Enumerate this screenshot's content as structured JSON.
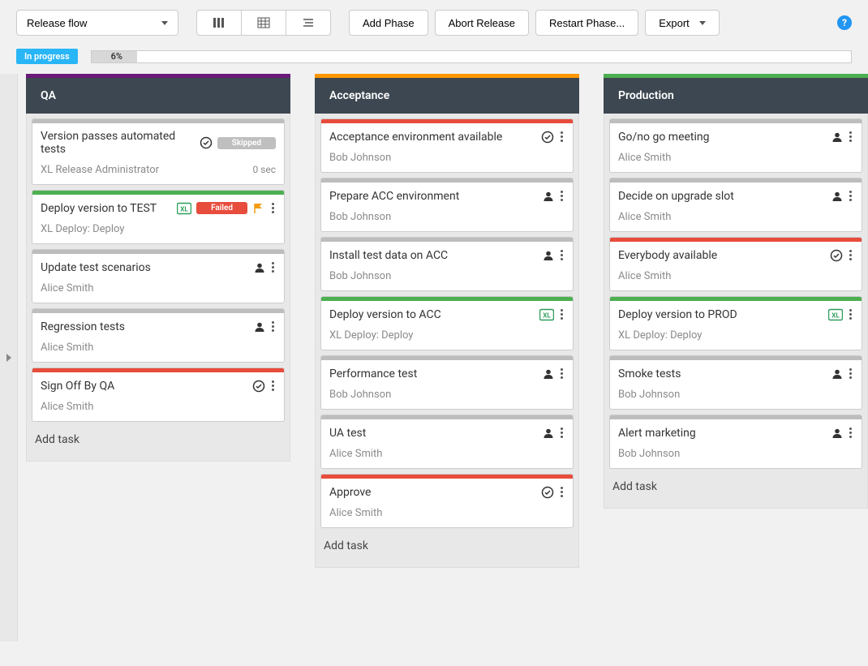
{
  "toolbar": {
    "view_label": "Release flow",
    "add_phase": "Add Phase",
    "abort_release": "Abort Release",
    "restart_phase": "Restart Phase...",
    "export": "Export"
  },
  "progress": {
    "status_label": "In progress",
    "percent_label": "6%",
    "percent_value": 6
  },
  "phases": [
    {
      "title": "QA",
      "color": "col-purple",
      "tasks": [
        {
          "title": "Version passes automated tests",
          "assignee": "XL Release Administrator",
          "bar": "bar-gray",
          "type": "gate",
          "chip": {
            "label": "Skipped",
            "cls": "chip-skipped"
          },
          "right_meta": "0 sec",
          "show_kebab": false,
          "show_person": false
        },
        {
          "title": "Deploy version to TEST",
          "assignee": "XL Deploy: Deploy",
          "bar": "bar-green",
          "type": "xl",
          "chip": {
            "label": "Failed",
            "cls": "chip-failed"
          },
          "flag": true,
          "show_kebab": true,
          "show_person": false
        },
        {
          "title": "Update test scenarios",
          "assignee": "Alice Smith",
          "bar": "bar-gray",
          "type": "person",
          "show_kebab": true,
          "show_person": true
        },
        {
          "title": "Regression tests",
          "assignee": "Alice Smith",
          "bar": "bar-gray",
          "type": "person",
          "show_kebab": true,
          "show_person": true
        },
        {
          "title": "Sign Off By QA",
          "assignee": "Alice Smith",
          "bar": "bar-red",
          "type": "gate",
          "show_kebab": true,
          "show_person": false
        }
      ],
      "add_task_label": "Add task"
    },
    {
      "title": "Acceptance",
      "color": "col-orange",
      "tasks": [
        {
          "title": "Acceptance environment available",
          "assignee": "Bob Johnson",
          "bar": "bar-red",
          "type": "gate",
          "show_kebab": true,
          "show_person": false
        },
        {
          "title": "Prepare ACC environment",
          "assignee": "Bob Johnson",
          "bar": "bar-gray",
          "type": "person",
          "show_kebab": true,
          "show_person": true
        },
        {
          "title": "Install test data on ACC",
          "assignee": "Bob Johnson",
          "bar": "bar-gray",
          "type": "person",
          "show_kebab": true,
          "show_person": true
        },
        {
          "title": "Deploy version to ACC",
          "assignee": "XL Deploy: Deploy",
          "bar": "bar-green",
          "type": "xl",
          "show_kebab": true,
          "show_person": false
        },
        {
          "title": "Performance test",
          "assignee": "Bob Johnson",
          "bar": "bar-gray",
          "type": "person",
          "show_kebab": true,
          "show_person": true
        },
        {
          "title": "UA test",
          "assignee": "Alice Smith",
          "bar": "bar-gray",
          "type": "person",
          "show_kebab": true,
          "show_person": true
        },
        {
          "title": "Approve",
          "assignee": "Alice Smith",
          "bar": "bar-red",
          "type": "gate",
          "show_kebab": true,
          "show_person": false
        }
      ],
      "add_task_label": "Add task"
    },
    {
      "title": "Production",
      "color": "col-green",
      "tasks": [
        {
          "title": "Go/no go meeting",
          "assignee": "Alice Smith",
          "bar": "bar-gray",
          "type": "person",
          "show_kebab": true,
          "show_person": true
        },
        {
          "title": "Decide on upgrade slot",
          "assignee": "Alice Smith",
          "bar": "bar-gray",
          "type": "person",
          "show_kebab": true,
          "show_person": true
        },
        {
          "title": "Everybody available",
          "assignee": "Alice Smith",
          "bar": "bar-red",
          "type": "gate",
          "show_kebab": true,
          "show_person": false
        },
        {
          "title": "Deploy version to PROD",
          "assignee": "XL Deploy: Deploy",
          "bar": "bar-green",
          "type": "xl",
          "show_kebab": true,
          "show_person": false
        },
        {
          "title": "Smoke tests",
          "assignee": "Bob Johnson",
          "bar": "bar-gray",
          "type": "person",
          "show_kebab": true,
          "show_person": true
        },
        {
          "title": "Alert marketing",
          "assignee": "Bob Johnson",
          "bar": "bar-gray",
          "type": "person",
          "show_kebab": true,
          "show_person": true
        }
      ],
      "add_task_label": "Add task"
    }
  ]
}
